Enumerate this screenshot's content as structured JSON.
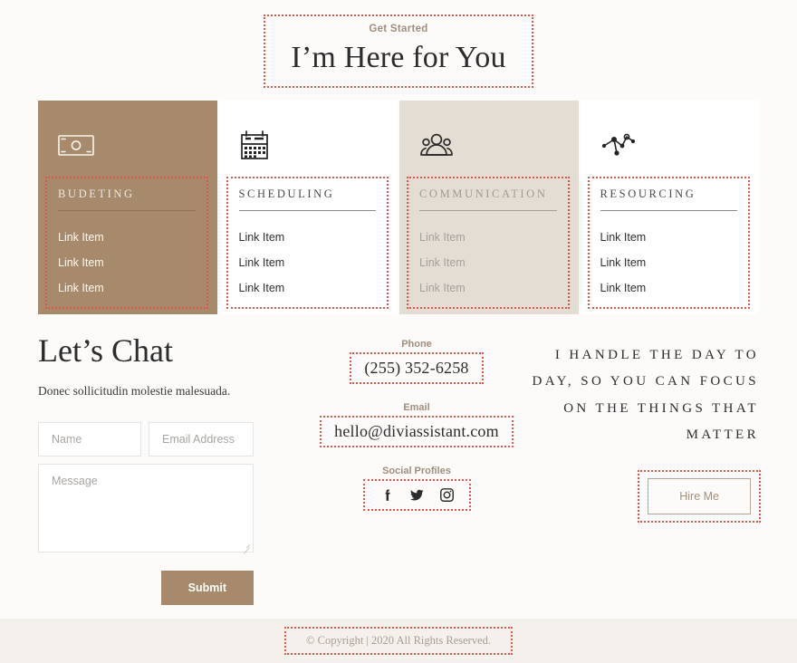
{
  "hero": {
    "eyebrow": "Get Started",
    "title": "I’m Here for You"
  },
  "cards": [
    {
      "icon": "money-icon",
      "title": "BUDETING",
      "links": [
        "Link Item",
        "Link Item",
        "Link Item"
      ],
      "background": "#a78a6b",
      "variant": "brown"
    },
    {
      "icon": "calendar-icon",
      "title": "SCHEDULING",
      "links": [
        "Link Item",
        "Link Item",
        "Link Item"
      ],
      "background": "#ffffff",
      "variant": "white"
    },
    {
      "icon": "people-icon",
      "title": "COMMUNICATION",
      "links": [
        "Link Item",
        "Link Item",
        "Link Item"
      ],
      "background": "#e4ddd3",
      "variant": "beige"
    },
    {
      "icon": "network-icon",
      "title": "RESOURCING",
      "links": [
        "Link Item",
        "Link Item",
        "Link Item"
      ],
      "background": "#ffffff",
      "variant": "white"
    }
  ],
  "contact": {
    "title": "Let’s Chat",
    "subtitle": "Donec sollicitudin molestie malesuada.",
    "form": {
      "name_placeholder": "Name",
      "email_placeholder": "Email Address",
      "message_placeholder": "Message",
      "submit_label": "Submit"
    },
    "info": {
      "phone_label": "Phone",
      "phone_value": "(255) 352-6258",
      "email_label": "Email",
      "email_value": "hello@diviassistant.com",
      "social_label": "Social Profiles",
      "social_icons": [
        "facebook-icon",
        "twitter-icon",
        "instagram-icon"
      ]
    },
    "pitch": {
      "text": "I handle the day to day, so you can focus on the things that matter",
      "cta_label": "Hire Me"
    }
  },
  "footer": {
    "text": "© Copyright | 2020 All Rights Reserved."
  },
  "colors": {
    "brand_brown": "#a78a6b",
    "beige": "#e4ddd3",
    "muted_tan": "#9e8e7e",
    "page_background": "#fdfbfa",
    "footer_background": "#f4f0ec",
    "annotation": "#e2574c"
  }
}
